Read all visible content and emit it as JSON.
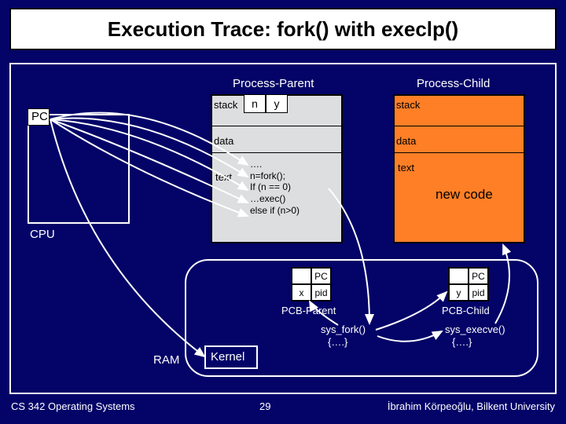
{
  "title": "Execution Trace: fork() with execlp()",
  "labels": {
    "process_parent": "Process-Parent",
    "process_child": "Process-Child",
    "stack_p": "stack",
    "data_p": "data",
    "text_p": "text",
    "stack_c": "stack",
    "data_c": "data",
    "text_c": "text",
    "new_code": "new code",
    "pc": "PC",
    "cpu": "CPU",
    "ram": "RAM",
    "kernel": "Kernel",
    "pcb_parent": "PCB-Parent",
    "pcb_child": "PCB-Child",
    "sys_fork": "sys_fork()",
    "sys_execve": "sys_execve()",
    "body": "{….}",
    "pc_col": "PC",
    "pid_col": "pid"
  },
  "cells": {
    "n": "n",
    "y": "y",
    "x": "x"
  },
  "code": {
    "l0": "….",
    "l1": "n=fork();",
    "l2": "If (n == 0)",
    "l3": "  …exec()",
    "l4": "else if (n>0)"
  },
  "footer": {
    "left": "CS 342 Operating Systems",
    "page": "29",
    "right": "İbrahim Körpeoğlu, Bilkent University"
  }
}
